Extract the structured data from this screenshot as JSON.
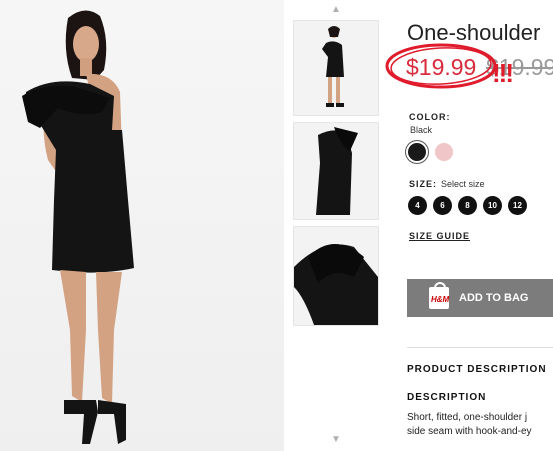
{
  "product": {
    "title": "One-shoulder",
    "price": "$19.99",
    "old_price": "$19.99",
    "annotation": "!!!"
  },
  "color": {
    "label": "COLOR:",
    "selected": "Black",
    "swatches": [
      "#1a1a1a",
      "#f1c6c8"
    ]
  },
  "size": {
    "label": "SIZE:",
    "hint": "Select size",
    "options": [
      "4",
      "6",
      "8",
      "10",
      "12"
    ],
    "guide": "SIZE GUIDE"
  },
  "cart": {
    "button": "ADD TO BAG",
    "bag_text": "H&M"
  },
  "description": {
    "section_title": "PRODUCT DESCRIPTION",
    "heading": "DESCRIPTION",
    "line1": "Short, fitted, one-shoulder j",
    "line2": "side seam with hook-and-ey"
  },
  "thumbnails": {
    "up_icon": "chevron-up-icon",
    "down_icon": "chevron-down-icon"
  }
}
